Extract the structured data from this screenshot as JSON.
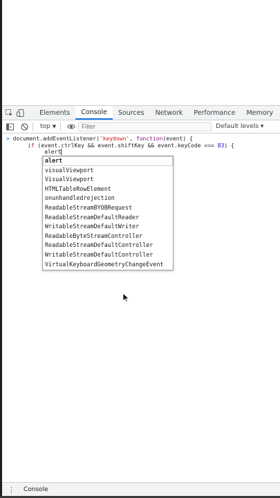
{
  "tabs": {
    "items": [
      "Elements",
      "Console",
      "Sources",
      "Network",
      "Performance",
      "Memory"
    ],
    "more": "»"
  },
  "toolbar": {
    "context": "top",
    "filter_placeholder": "Filter",
    "levels": "Default levels ▾"
  },
  "console": {
    "prompt": ">",
    "line1_a": "document.addEventListener(",
    "line1_str": "'keydown'",
    "line1_b": ", ",
    "line1_kw": "function",
    "line1_c": "(event) {",
    "line2_indent": "     ",
    "line2_kw": "if",
    "line2_a": " (event.ctrlKey && event.shiftKey && event.keyCode === ",
    "line2_num": "83",
    "line2_b": ") {",
    "line3_indent": "          ",
    "line3_text": "alert"
  },
  "autocomplete": [
    "alert",
    "visualViewport",
    "VisualViewport",
    "HTMLTableRowElement",
    "onunhandledrejection",
    "ReadableStreamBYOBRequest",
    "ReadableStreamDefaultReader",
    "WritableStreamDefaultWriter",
    "ReadableByteStreamController",
    "ReadableStreamDefaultController",
    "WritableStreamDefaultController",
    "VirtualKeyboardGeometryChangeEvent"
  ],
  "drawer": {
    "tab": "Console"
  },
  "colors": {
    "accent": "#1a73e8",
    "keyword": "#881280",
    "string": "#c41a16",
    "number": "#1c00cf"
  },
  "icons": [
    "inspect-element-icon",
    "device-toolbar-icon",
    "sidebar-toggle-icon",
    "clear-console-icon",
    "eye-icon",
    "cursor-icon",
    "kebab-menu-icon"
  ]
}
